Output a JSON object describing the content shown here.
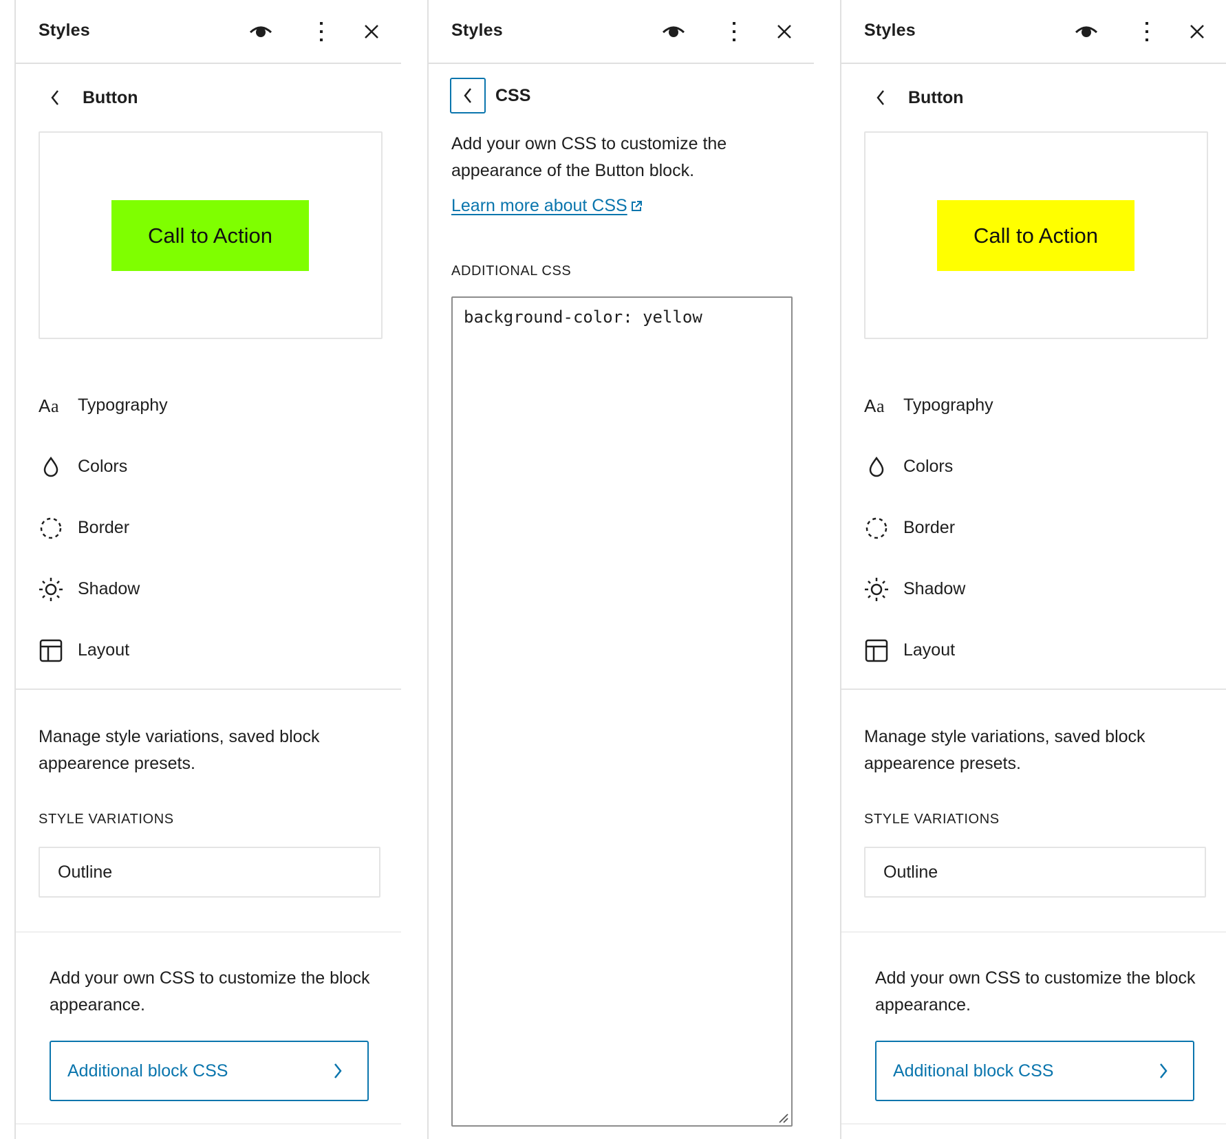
{
  "colors": {
    "accent": "#0a75ad",
    "cta_green": "#7fff00",
    "cta_yellow": "#ffff00",
    "text": "#1e1e1e",
    "border": "#e4e4e4"
  },
  "panels": [
    {
      "header": {
        "title": "Styles",
        "icons": [
          "eye-icon",
          "more-vertical-icon",
          "close-icon"
        ]
      },
      "nav_title": "Button",
      "preview": {
        "button_label": "Call to Action",
        "button_color": "#7fff00"
      },
      "menu": [
        {
          "label": "Typography",
          "icon": "typography-icon"
        },
        {
          "label": "Colors",
          "icon": "droplet-icon"
        },
        {
          "label": "Border",
          "icon": "border-icon"
        },
        {
          "label": "Shadow",
          "icon": "shadow-icon"
        },
        {
          "label": "Layout",
          "icon": "layout-icon"
        }
      ],
      "manage_text": "Manage style variations, saved block appearence presets.",
      "style_variations_label": "STYLE VARIATIONS",
      "style_variation_value": "Outline",
      "add_css_text": "Add your own CSS to customize the block appearance.",
      "add_css_button": "Additional block CSS"
    },
    {
      "header": {
        "title": "Styles",
        "icons": [
          "eye-icon",
          "more-vertical-icon",
          "close-icon"
        ]
      },
      "nav_title": "CSS",
      "description": "Add your own CSS to customize the appearance of the Button block.",
      "learn_link": "Learn more about CSS",
      "additional_css_label": "ADDITIONAL CSS",
      "css_value": "background-color: yellow"
    },
    {
      "header": {
        "title": "Styles",
        "icons": [
          "eye-icon",
          "more-vertical-icon",
          "close-icon"
        ]
      },
      "nav_title": "Button",
      "preview": {
        "button_label": "Call to Action",
        "button_color": "#ffff00"
      },
      "menu": [
        {
          "label": "Typography",
          "icon": "typography-icon"
        },
        {
          "label": "Colors",
          "icon": "droplet-icon"
        },
        {
          "label": "Border",
          "icon": "border-icon"
        },
        {
          "label": "Shadow",
          "icon": "shadow-icon"
        },
        {
          "label": "Layout",
          "icon": "layout-icon"
        }
      ],
      "manage_text": "Manage style variations, saved block appearence presets.",
      "style_variations_label": "STYLE VARIATIONS",
      "style_variation_value": "Outline",
      "add_css_text": "Add your own CSS to customize the block appearance.",
      "add_css_button": "Additional block CSS"
    }
  ]
}
